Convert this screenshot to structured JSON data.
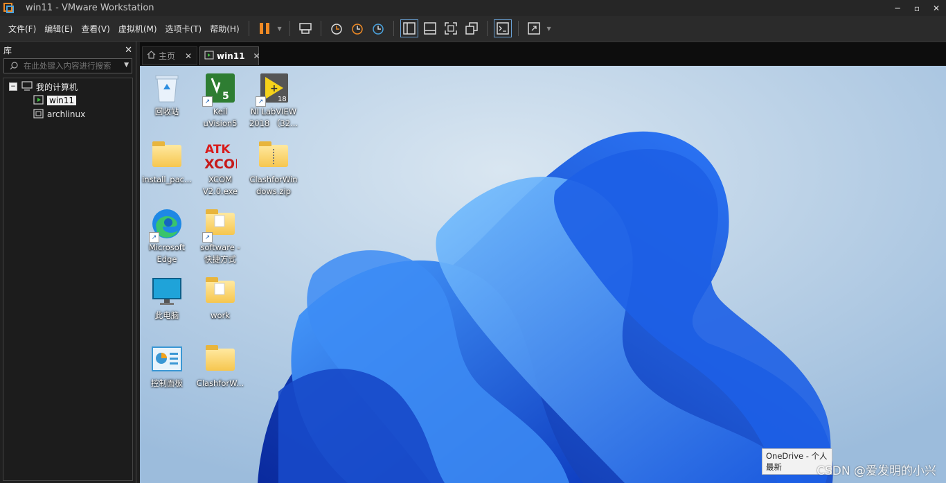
{
  "window": {
    "title": "win11 - VMware Workstation"
  },
  "menu": [
    "文件(F)",
    "编辑(E)",
    "查看(V)",
    "虚拟机(M)",
    "选项卡(T)",
    "帮助(H)"
  ],
  "library": {
    "title": "库",
    "search_placeholder": "在此处键入内容进行搜索",
    "root": "我的计算机",
    "vms": [
      "win11",
      "archlinux"
    ]
  },
  "tabs": {
    "home": "主页",
    "vm": "win11"
  },
  "desktop_icons": [
    {
      "label": "回收站"
    },
    {
      "label": "Keil\nuVision5"
    },
    {
      "label": "NI LabVIEW\n2018 （32..."
    },
    {
      "label": "install_pac..."
    },
    {
      "label": "XCOM\nV2.0.exe"
    },
    {
      "label": "ClashforWin\ndows.zip"
    },
    {
      "label": "Microsoft\nEdge"
    },
    {
      "label": "software -\n快捷方式"
    },
    {
      "label": "此电脑"
    },
    {
      "label": "work"
    },
    {
      "label": "控制面板"
    },
    {
      "label": "ClashforW..."
    }
  ],
  "tooltip": {
    "line1": "OneDrive - 个人",
    "line2": "最新"
  },
  "watermark": "CSDN @爱发明的小兴",
  "colors": {
    "pause": "#f08a24",
    "accent": "#1a6fe8"
  }
}
